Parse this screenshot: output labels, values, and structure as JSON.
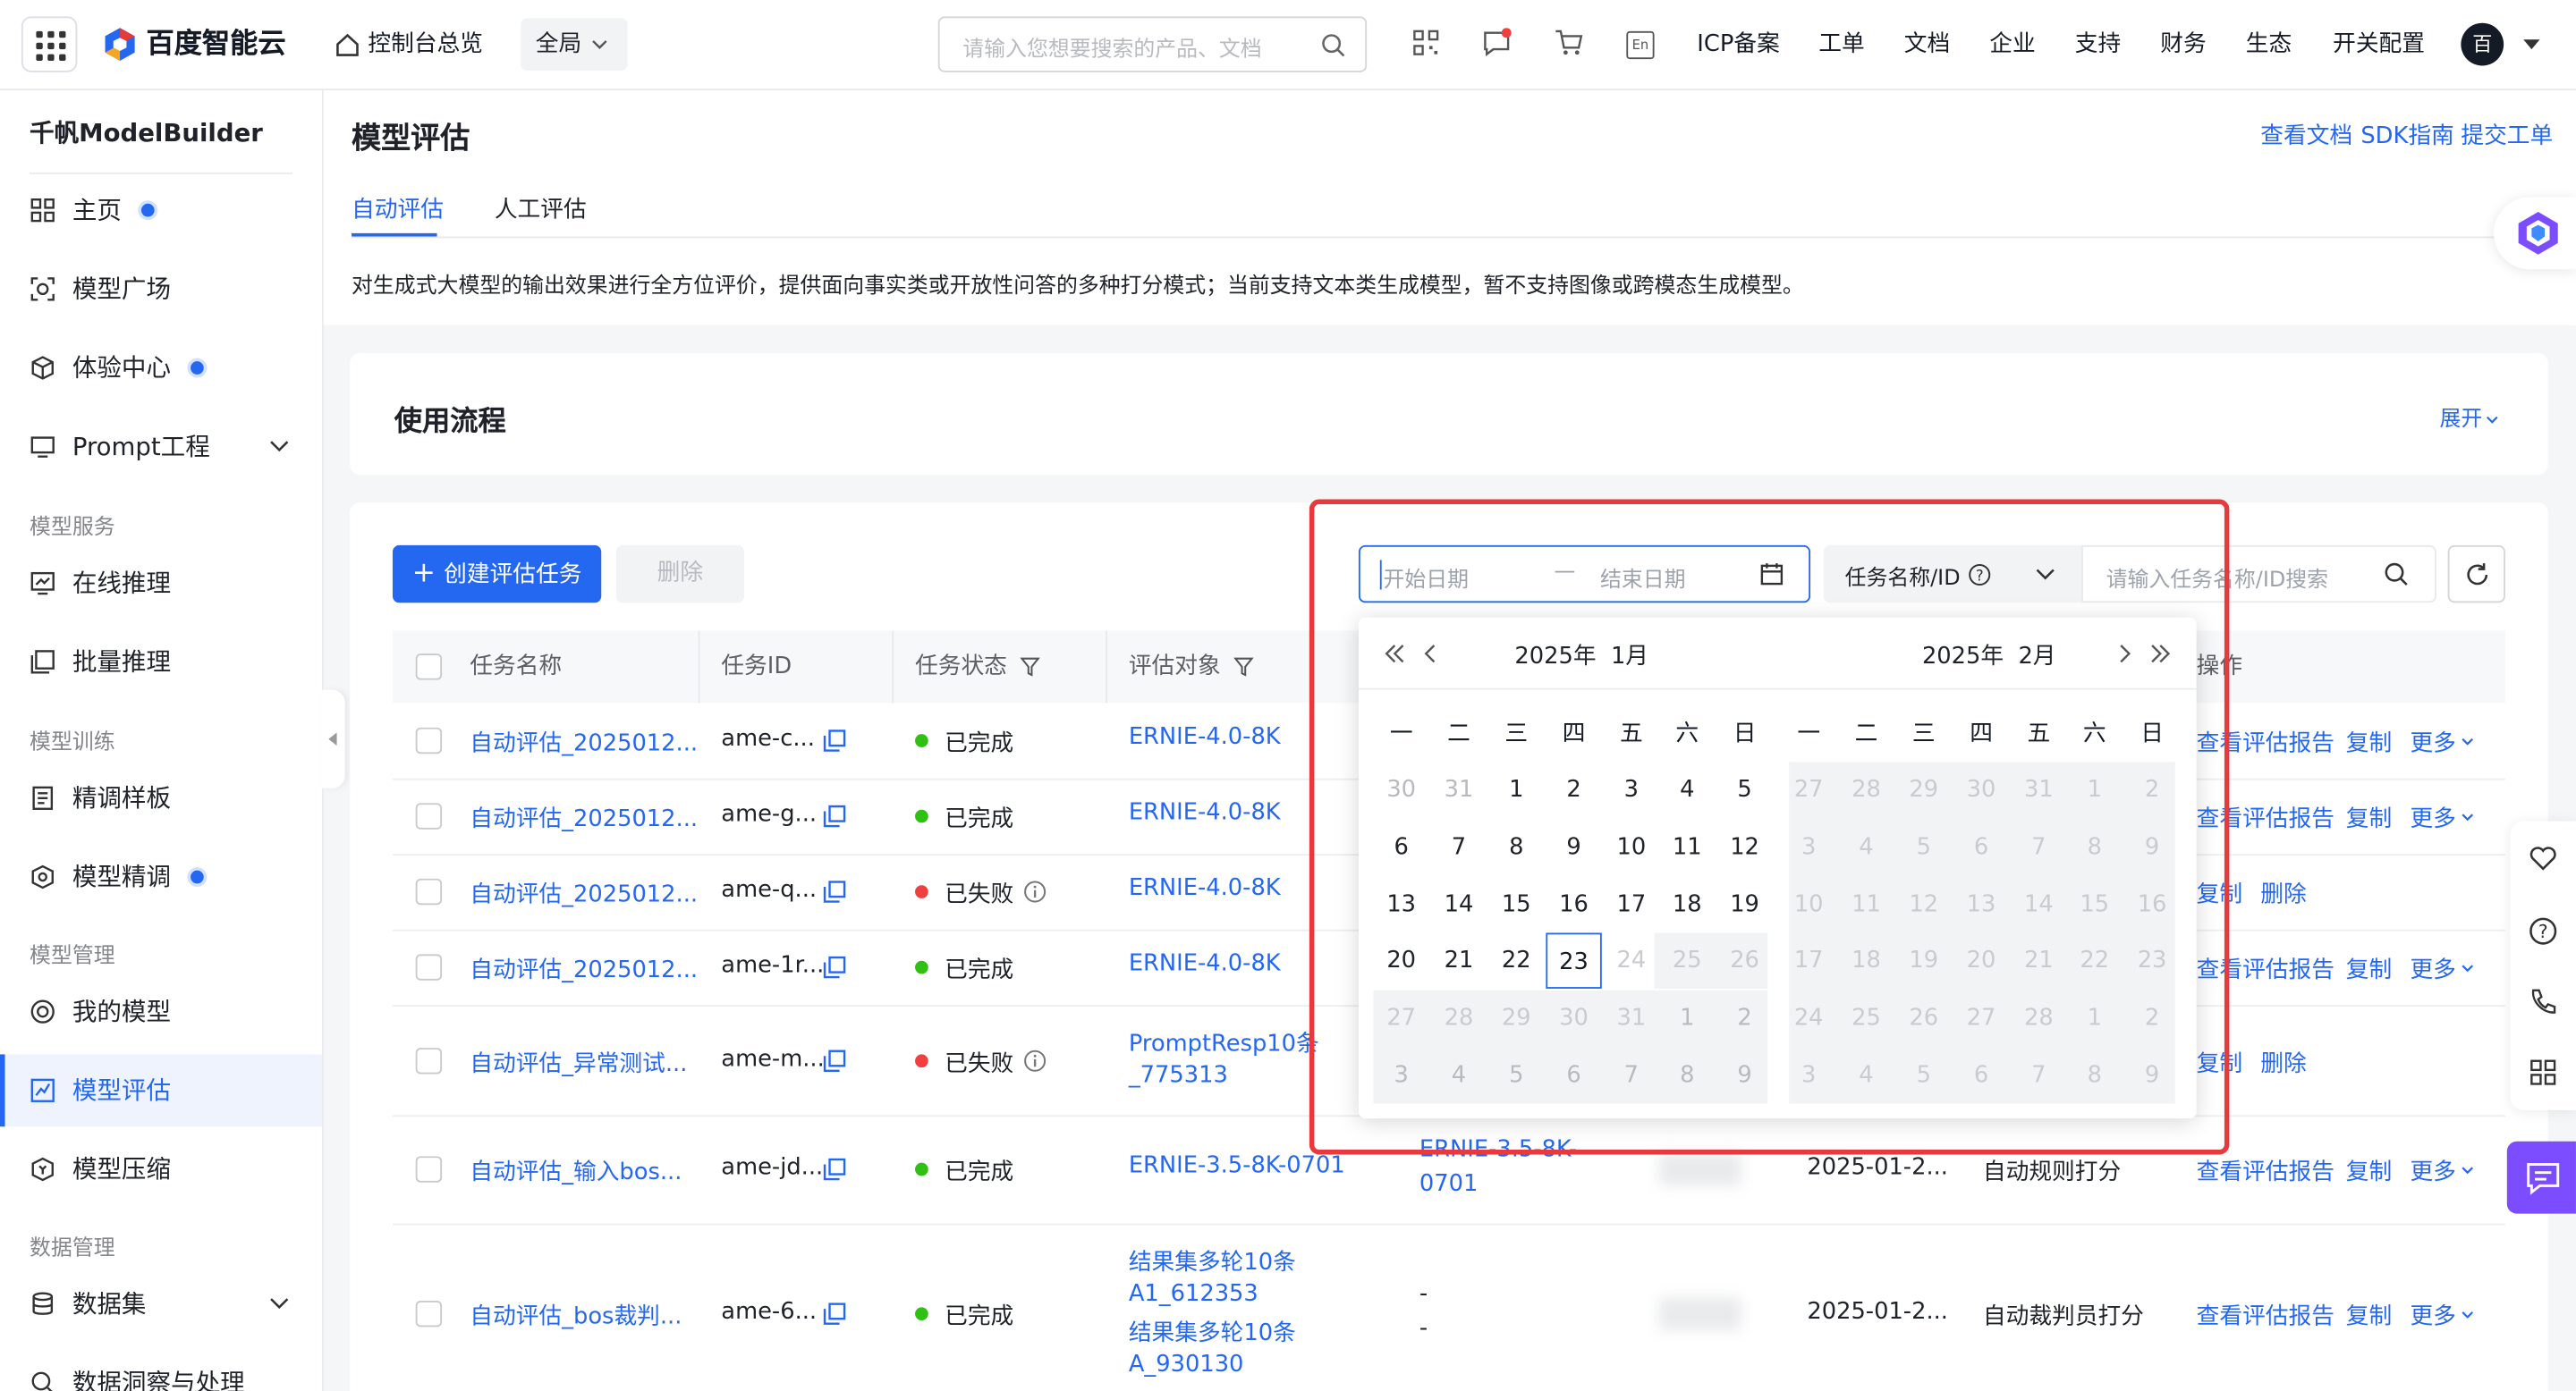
{
  "topbar": {
    "brand": "百度智能云",
    "console": "控制台总览",
    "scope": "全局",
    "search_placeholder": "请输入您想要搜索的产品、文档",
    "nav": [
      "ICP备案",
      "工单",
      "文档",
      "企业",
      "支持",
      "财务",
      "生态",
      "开关配置"
    ],
    "lang_badge": "En",
    "avatar": "百"
  },
  "sidebar": {
    "title": "千帆ModelBuilder",
    "items": [
      {
        "label": "主页",
        "icon": "grid-icon",
        "dot": true
      },
      {
        "label": "模型广场",
        "icon": "model-square-icon",
        "dot": false
      },
      {
        "label": "体验中心",
        "icon": "cube-icon",
        "dot": true
      },
      {
        "label": "Prompt工程",
        "icon": "prompt-icon",
        "dot": false,
        "expand": true
      }
    ],
    "sections": [
      {
        "title": "模型服务",
        "items": [
          "在线推理",
          "批量推理"
        ]
      },
      {
        "title": "模型训练",
        "items": [
          "精调样板",
          "模型精调"
        ]
      },
      {
        "title": "模型管理",
        "items": [
          "我的模型",
          "模型评估",
          "模型压缩"
        ]
      },
      {
        "title": "数据管理",
        "items": [
          "数据集",
          "数据洞察与处理"
        ]
      }
    ],
    "active": "模型评估"
  },
  "header": {
    "title": "模型评估",
    "links": [
      "查看文档",
      "SDK指南",
      "提交工单"
    ],
    "tabs": [
      "自动评估",
      "人工评估"
    ],
    "active_tab": "自动评估",
    "description": "对生成式大模型的输出效果进行全方位评价，提供面向事实类或开放性问答的多种打分模式；当前支持文本类生成模型，暂不支持图像或跨模态生成模型。"
  },
  "flow": {
    "title": "使用流程",
    "expand": "展开"
  },
  "toolbar": {
    "create": "创建评估任务",
    "delete": "删除",
    "start_placeholder": "开始日期",
    "end_placeholder": "结束日期",
    "filter_type": "任务名称/ID",
    "query_placeholder": "请输入任务名称/ID搜索"
  },
  "table": {
    "columns": [
      "任务名称",
      "任务ID",
      "任务状态",
      "评估对象",
      "操作"
    ],
    "rows": [
      {
        "name": "自动评估_2025012...",
        "id": "ame-c...",
        "status": "已完成",
        "status_color": "#30bf13",
        "target": [
          "ERNIE-4.0-8K"
        ],
        "actions": [
          "查看评估报告",
          "复制",
          "更多"
        ]
      },
      {
        "name": "自动评估_2025012...",
        "id": "ame-g...",
        "status": "已完成",
        "status_color": "#30bf13",
        "target": [
          "ERNIE-4.0-8K"
        ],
        "actions": [
          "查看评估报告",
          "复制",
          "更多"
        ]
      },
      {
        "name": "自动评估_2025012...",
        "id": "ame-q...",
        "status": "已失败",
        "status_color": "#f03f3f",
        "target": [
          "ERNIE-4.0-8K"
        ],
        "actions": [
          "复制",
          "删除"
        ]
      },
      {
        "name": "自动评估_2025012...",
        "id": "ame-1r...",
        "status": "已完成",
        "status_color": "#30bf13",
        "target": [
          "ERNIE-4.0-8K"
        ],
        "actions": [
          "查看评估报告",
          "复制",
          "更多"
        ]
      },
      {
        "name": "自动评估_异常测试...",
        "id": "ame-m...",
        "status": "已失败",
        "status_color": "#f03f3f",
        "target": [
          "PromptResp10条",
          "_775313"
        ],
        "actions": [
          "复制",
          "删除"
        ]
      },
      {
        "name": "自动评估_输入bos...",
        "id": "ame-jd...",
        "status": "已完成",
        "status_color": "#30bf13",
        "target": [
          "ERNIE-3.5-8K-0701"
        ],
        "target2": [
          "ERNIE-3.5-8K-",
          "0701"
        ],
        "time": "2025-01-2...",
        "method": "自动规则打分",
        "actions": [
          "查看评估报告",
          "复制",
          "更多"
        ]
      },
      {
        "name": "自动评估_bos裁判...",
        "id": "ame-6...",
        "status": "已完成",
        "status_color": "#30bf13",
        "target": [
          "结果集多轮10条",
          "A1_612353",
          "结果集多轮10条",
          "A_930130"
        ],
        "target2": [
          "-",
          "-"
        ],
        "time": "2025-01-2...",
        "method": "自动裁判员打分",
        "actions": [
          "查看评估报告",
          "复制",
          "更多"
        ]
      }
    ]
  },
  "calendar": {
    "left_title": "2025年  1月",
    "right_title": "2025年  2月",
    "weekdays": [
      "一",
      "二",
      "三",
      "四",
      "五",
      "六",
      "日"
    ],
    "left_days": [
      "30",
      "31",
      "1",
      "2",
      "3",
      "4",
      "5",
      "6",
      "7",
      "8",
      "9",
      "10",
      "11",
      "12",
      "13",
      "14",
      "15",
      "16",
      "17",
      "18",
      "19",
      "20",
      "21",
      "22",
      "23",
      "24",
      "25",
      "26",
      "27",
      "28",
      "29",
      "30",
      "31",
      "1",
      "2",
      "3",
      "4",
      "5",
      "6",
      "7",
      "8",
      "9"
    ],
    "right_days": [
      "27",
      "28",
      "29",
      "30",
      "31",
      "1",
      "2",
      "3",
      "4",
      "5",
      "6",
      "7",
      "8",
      "9",
      "10",
      "11",
      "12",
      "13",
      "14",
      "15",
      "16",
      "17",
      "18",
      "19",
      "20",
      "21",
      "22",
      "23",
      "24",
      "25",
      "26",
      "27",
      "28",
      "1",
      "2",
      "3",
      "4",
      "5",
      "6",
      "7",
      "8",
      "9"
    ],
    "today": "23"
  }
}
